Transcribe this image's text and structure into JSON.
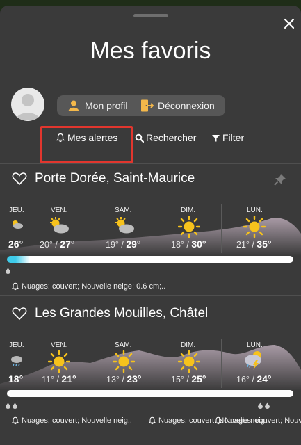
{
  "header": {
    "title": "Mes favoris",
    "close_icon": "close-icon"
  },
  "profile": {
    "profile_label": "Mon profil",
    "logout_label": "Déconnexion"
  },
  "actions": {
    "alerts_label": "Mes alertes",
    "search_label": "Rechercher",
    "filter_label": "Filter"
  },
  "favorites": [
    {
      "name": "Porte Dorée, Saint-Maurice",
      "days": [
        {
          "label": "JEU.",
          "icon": "partly-cloudy-icon",
          "temps": "26°",
          "min": "",
          "max": ""
        },
        {
          "label": "VEN.",
          "icon": "sun-cloud-icon",
          "min": "20° / ",
          "max": "27°"
        },
        {
          "label": "SAM.",
          "icon": "sun-cloud-icon",
          "min": "19° / ",
          "max": "29°"
        },
        {
          "label": "DIM.",
          "icon": "sun-icon",
          "min": "18° / ",
          "max": "30°"
        },
        {
          "label": "LUN.",
          "icon": "sun-icon",
          "min": "21° / ",
          "max": "35°"
        }
      ],
      "precip_fraction": 0.06,
      "alert": "Nuages: couvert; Nouvelle neige: 0.6 cm;.."
    },
    {
      "name": "Les Grandes Mouilles, Châtel",
      "days": [
        {
          "label": "JEU.",
          "icon": "rain-cloud-icon",
          "temps": "18°",
          "min": "",
          "max": ""
        },
        {
          "label": "VEN.",
          "icon": "sun-icon",
          "min": "11° / ",
          "max": "21°"
        },
        {
          "label": "SAM.",
          "icon": "sun-icon",
          "min": "13° / ",
          "max": "23°"
        },
        {
          "label": "DIM.",
          "icon": "sun-icon",
          "min": "15° / ",
          "max": "25°"
        },
        {
          "label": "LUN.",
          "icon": "storm-cloud-icon",
          "min": "16° / ",
          "max": "24°"
        }
      ],
      "precip_fraction": 0.0,
      "alerts": [
        "Nuages: couvert; Nouvelle neig..",
        "Nuages: couvert; Nouvelle neig..",
        "Nuages: couvert; Nouvelle neig.."
      ]
    }
  ],
  "colors": {
    "accent_highlight": "#e2362e",
    "precip": "#3ecbea",
    "sun": "#f6c21c"
  }
}
